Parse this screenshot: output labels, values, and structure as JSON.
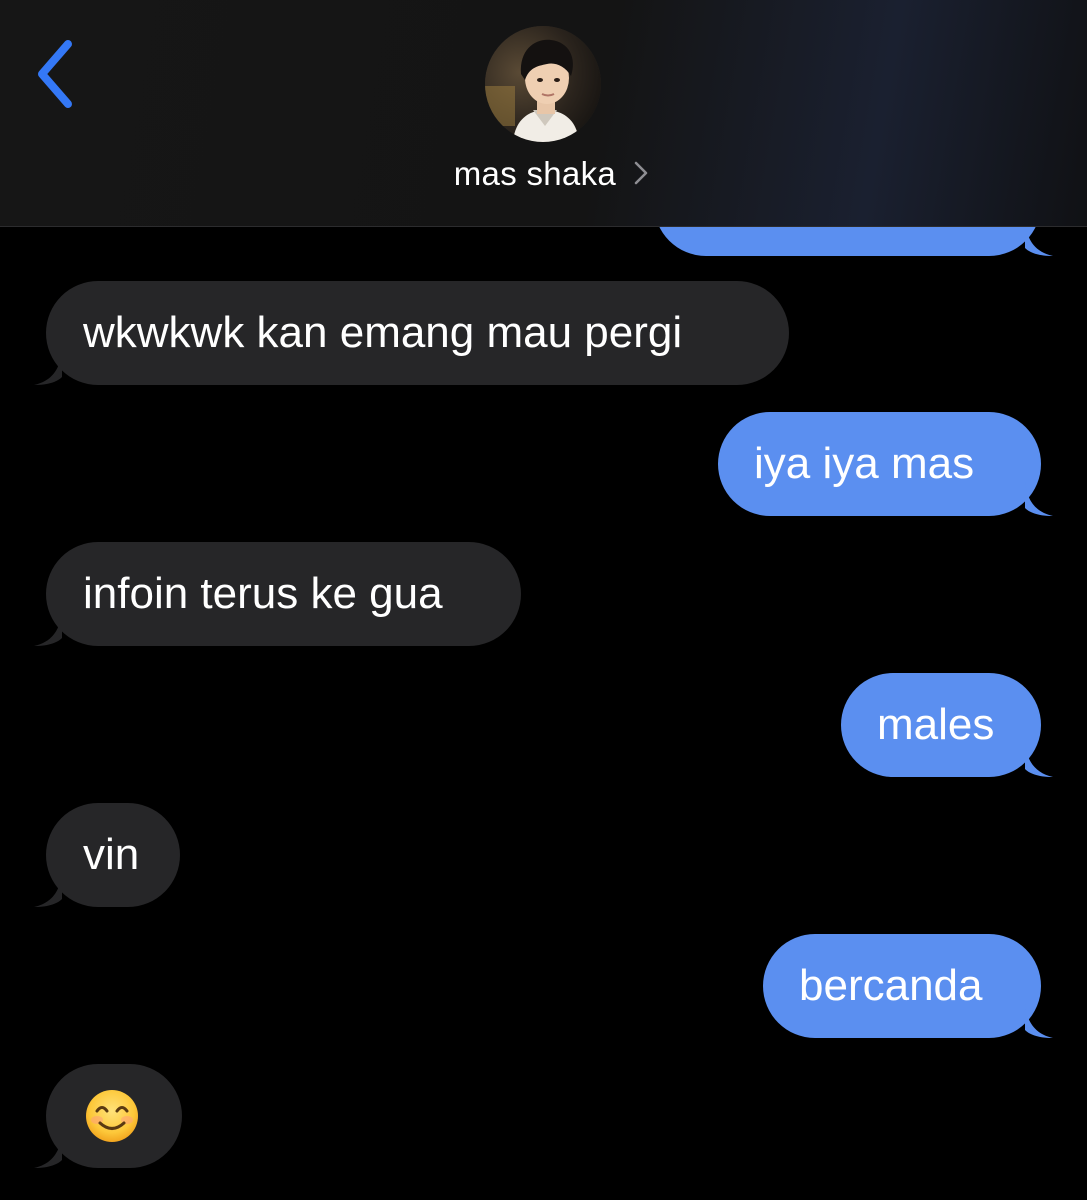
{
  "header": {
    "contact_name": "mas shaka",
    "back_icon": "chevron-left-icon",
    "detail_icon": "chevron-right-icon"
  },
  "colors": {
    "sent_bubble": "#5b8ff0",
    "received_bubble": "#262628",
    "accent": "#3478f6",
    "background": "#000000"
  },
  "messages": [
    {
      "direction": "sent",
      "text": ""
    },
    {
      "direction": "received",
      "text": "wkwkwk kan emang mau pergi"
    },
    {
      "direction": "sent",
      "text": "iya iya mas"
    },
    {
      "direction": "received",
      "text": "infoin terus ke gua"
    },
    {
      "direction": "sent",
      "text": "males"
    },
    {
      "direction": "received",
      "text": "vin"
    },
    {
      "direction": "sent",
      "text": "bercanda"
    },
    {
      "direction": "received",
      "text": "😊",
      "emoji_icon": "smiling-face-emoji-icon"
    }
  ]
}
